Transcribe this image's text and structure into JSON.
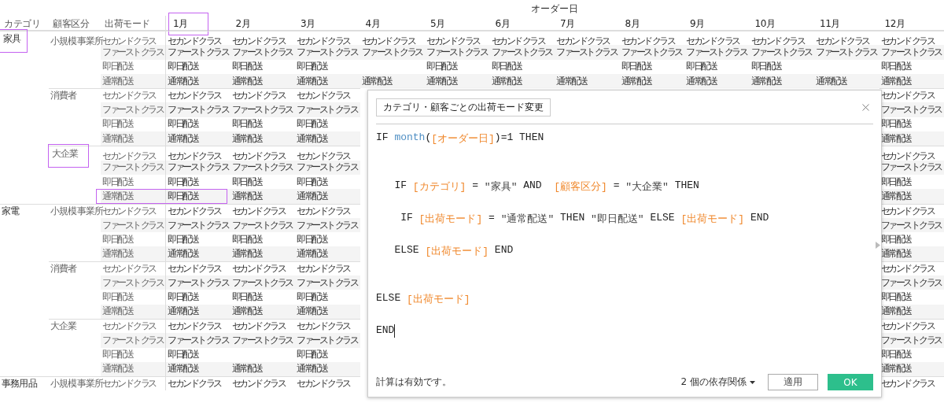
{
  "header": {
    "group_label": "オーダー日",
    "row_headers": [
      "カテゴリ",
      "顧客区分",
      "出荷モード"
    ],
    "months": [
      {
        "label": "1月",
        "highlighted": true
      },
      {
        "label": "2月",
        "highlighted": false
      },
      {
        "label": "3月",
        "highlighted": false
      },
      {
        "label": "4月",
        "highlighted": false
      },
      {
        "label": "5月",
        "highlighted": false
      },
      {
        "label": "6月",
        "highlighted": false
      },
      {
        "label": "7月",
        "highlighted": false
      },
      {
        "label": "8月",
        "highlighted": false
      },
      {
        "label": "9月",
        "highlighted": false
      },
      {
        "label": "10月",
        "highlighted": false
      },
      {
        "label": "11月",
        "highlighted": false
      },
      {
        "label": "12月",
        "highlighted": false
      }
    ]
  },
  "categories": [
    {
      "name": "家具",
      "highlighted": true,
      "segments": [
        {
          "name": "小規模事業所",
          "highlighted": false,
          "rows": [
            {
              "mode": "セカンド クラス",
              "highlighted": false,
              "cells": [
                "セカンド クラス",
                "セカンド クラス",
                "セカンド クラス",
                "セカンド クラス",
                "セカンド クラス",
                "セカンド クラス",
                "セカンド クラス",
                "セカンド クラス",
                "セカンド クラス",
                "セカンド クラス",
                "セカンド クラス",
                "セカンド クラス"
              ]
            },
            {
              "mode": "ファースト クラス",
              "highlighted": false,
              "cells": [
                "ファースト クラス",
                "ファースト クラス",
                "ファースト クラス",
                "ファースト クラス",
                "ファースト クラス",
                "ファースト クラス",
                "ファースト クラス",
                "ファースト クラス",
                "ファースト クラス",
                "ファースト クラス",
                "ファースト クラス",
                "ファースト クラス"
              ]
            },
            {
              "mode": "即日配送",
              "highlighted": false,
              "cells": [
                "即日配送",
                "即日配送",
                "即日配送",
                null,
                "即日配送",
                "即日配送",
                null,
                "即日配送",
                "即日配送",
                "即日配送",
                null,
                "即日配送"
              ]
            },
            {
              "mode": "通常配送",
              "highlighted": false,
              "cells": [
                "通常配送",
                "通常配送",
                "通常配送",
                "通常配送",
                "通常配送",
                "通常配送",
                "通常配送",
                "通常配送",
                "通常配送",
                "通常配送",
                "通常配送",
                "通常配送"
              ]
            }
          ]
        },
        {
          "name": "消費者",
          "highlighted": false,
          "rows": [
            {
              "mode": "セカンド クラス",
              "highlighted": false,
              "cells": [
                "セカンド クラス",
                "セカンド クラス",
                "セカンド クラス",
                "セカンド クラス"
              ]
            },
            {
              "mode": "ファースト クラス",
              "highlighted": false,
              "cells": [
                "ファースト クラス",
                "ファースト クラス",
                "ファースト クラス",
                "ファースト クラス"
              ]
            },
            {
              "mode": "即日配送",
              "highlighted": false,
              "cells": [
                "即日配送",
                "即日配送",
                "即日配送",
                "即日配送"
              ]
            },
            {
              "mode": "通常配送",
              "highlighted": false,
              "cells": [
                "通常配送",
                "通常配送",
                "通常配送",
                "通常配送"
              ]
            }
          ]
        },
        {
          "name": "大企業",
          "highlighted": true,
          "rows": [
            {
              "mode": "セカンド クラス",
              "highlighted": false,
              "cells": [
                "セカンド クラス",
                "セカンド クラス",
                "セカンド クラス",
                "セカンド クラス"
              ]
            },
            {
              "mode": "ファースト クラス",
              "highlighted": false,
              "cells": [
                "ファースト クラス",
                "ファースト クラス",
                "ファースト クラス",
                "ファースト クラス"
              ]
            },
            {
              "mode": "即日配送",
              "highlighted": false,
              "cells": [
                "即日配送",
                "即日配送",
                "即日配送",
                "即日配送"
              ]
            },
            {
              "mode": "通常配送",
              "highlighted": true,
              "cells": [
                "即日配送",
                "通常配送",
                "通常配送",
                "通常配送"
              ]
            }
          ]
        }
      ]
    },
    {
      "name": "家電",
      "highlighted": false,
      "segments": [
        {
          "name": "小規模事業所",
          "highlighted": false,
          "rows": [
            {
              "mode": "セカンド クラス",
              "highlighted": false,
              "cells": [
                "セカンド クラス",
                "セカンド クラス",
                "セカンド クラス",
                "セカンド クラス"
              ]
            },
            {
              "mode": "ファースト クラス",
              "highlighted": false,
              "cells": [
                "ファースト クラス",
                "ファースト クラス",
                "ファースト クラス",
                "ファースト クラス"
              ]
            },
            {
              "mode": "即日配送",
              "highlighted": false,
              "cells": [
                "即日配送",
                "即日配送",
                "即日配送",
                "即日配送"
              ]
            },
            {
              "mode": "通常配送",
              "highlighted": false,
              "cells": [
                "通常配送",
                "通常配送",
                "通常配送",
                "通常配送"
              ]
            }
          ]
        },
        {
          "name": "消費者",
          "highlighted": false,
          "rows": [
            {
              "mode": "セカンド クラス",
              "highlighted": false,
              "cells": [
                "セカンド クラス",
                "セカンド クラス",
                "セカンド クラス",
                "セカンド クラス"
              ]
            },
            {
              "mode": "ファースト クラス",
              "highlighted": false,
              "cells": [
                "ファースト クラス",
                "ファースト クラス",
                "ファースト クラス",
                "ファースト クラス"
              ]
            },
            {
              "mode": "即日配送",
              "highlighted": false,
              "cells": [
                "即日配送",
                "即日配送",
                "即日配送",
                "即日配送"
              ]
            },
            {
              "mode": "通常配送",
              "highlighted": false,
              "cells": [
                "通常配送",
                "通常配送",
                "通常配送",
                "通常配送"
              ]
            }
          ]
        },
        {
          "name": "大企業",
          "highlighted": false,
          "rows": [
            {
              "mode": "セカンド クラス",
              "highlighted": false,
              "cells": [
                "セカンド クラス",
                "セカンド クラス",
                "セカンド クラス",
                "セカンド クラス"
              ]
            },
            {
              "mode": "ファースト クラス",
              "highlighted": false,
              "cells": [
                "ファースト クラス",
                "ファースト クラス",
                "ファースト クラス",
                "ファースト クラス"
              ]
            },
            {
              "mode": "即日配送",
              "highlighted": false,
              "cells": [
                "即日配送",
                null,
                "即日配送",
                "即日配送"
              ]
            },
            {
              "mode": "通常配送",
              "highlighted": false,
              "cells": [
                "通常配送",
                "通常配送",
                "通常配送",
                "通常配送"
              ]
            }
          ]
        }
      ]
    },
    {
      "name": "事務用品",
      "highlighted": false,
      "segments": [
        {
          "name": "小規模事業所",
          "highlighted": false,
          "rows": [
            {
              "mode": "セカンド クラス",
              "highlighted": false,
              "cells": [
                "セカンド クラス",
                "セカンド クラス",
                "セカンド クラス",
                "セカンド クラス"
              ]
            }
          ]
        }
      ]
    }
  ],
  "dialog": {
    "name": "カテゴリ・顧客ごとの出荷モード変更",
    "lines": [
      {
        "gap_before": false,
        "tokens": [
          {
            "kind": "keyword",
            "text": "IF "
          },
          {
            "kind": "function",
            "text": "month"
          },
          {
            "kind": "plain",
            "text": "("
          },
          {
            "kind": "field",
            "text": "[オーダー日]"
          },
          {
            "kind": "plain",
            "text": ")=1 "
          },
          {
            "kind": "keyword",
            "text": "THEN"
          }
        ]
      },
      {
        "gap_before": true,
        "tokens": [
          {
            "kind": "keyword",
            "text": "   IF "
          },
          {
            "kind": "field",
            "text": "[カテゴリ]"
          },
          {
            "kind": "plain",
            "text": " = "
          },
          {
            "kind": "string",
            "text": "\"家具\""
          },
          {
            "kind": "keyword",
            "text": " AND  "
          },
          {
            "kind": "field",
            "text": "[顧客区分]"
          },
          {
            "kind": "plain",
            "text": " = "
          },
          {
            "kind": "string",
            "text": "\"大企業\""
          },
          {
            "kind": "keyword",
            "text": " THEN"
          }
        ]
      },
      {
        "gap_before": false,
        "tokens": [
          {
            "kind": "keyword",
            "text": "    IF "
          },
          {
            "kind": "field",
            "text": "[出荷モード]"
          },
          {
            "kind": "plain",
            "text": " = "
          },
          {
            "kind": "string",
            "text": "\"通常配送\""
          },
          {
            "kind": "keyword",
            "text": " THEN "
          },
          {
            "kind": "string",
            "text": "\"即日配送\""
          },
          {
            "kind": "keyword",
            "text": " ELSE "
          },
          {
            "kind": "field",
            "text": "[出荷モード]"
          },
          {
            "kind": "keyword",
            "text": " END"
          }
        ]
      },
      {
        "gap_before": false,
        "tokens": [
          {
            "kind": "keyword",
            "text": "   ELSE "
          },
          {
            "kind": "field",
            "text": "[出荷モード]"
          },
          {
            "kind": "keyword",
            "text": " END"
          }
        ]
      },
      {
        "gap_before": true,
        "tokens": [
          {
            "kind": "keyword",
            "text": "ELSE "
          },
          {
            "kind": "field",
            "text": "[出荷モード]"
          }
        ]
      },
      {
        "gap_before": false,
        "cursor": true,
        "tokens": [
          {
            "kind": "keyword",
            "text": "END"
          }
        ]
      }
    ],
    "status": "計算は有効です。",
    "dependencies": "2 個の依存関係",
    "buttons": [
      {
        "label": "適用",
        "kind": "secondary"
      },
      {
        "label": "OK",
        "kind": "primary"
      }
    ]
  }
}
